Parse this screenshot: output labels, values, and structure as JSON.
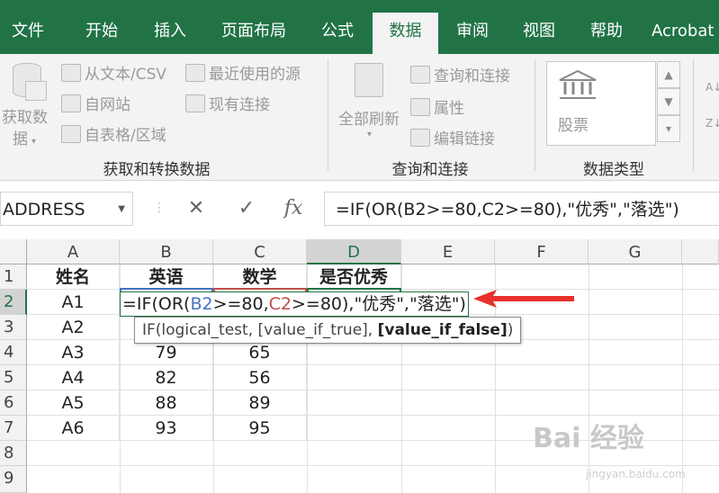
{
  "tabs": [
    "文件",
    "开始",
    "插入",
    "页面布局",
    "公式",
    "数据",
    "审阅",
    "视图",
    "帮助",
    "Acrobat"
  ],
  "active_tab": "数据",
  "ribbon": {
    "get_data": {
      "label_line1": "获取数",
      "label_line2": "据"
    },
    "from_text": "从文本/CSV",
    "from_web": "自网站",
    "from_table": "自表格/区域",
    "recent_sources": "最近使用的源",
    "existing_connections": "现有连接",
    "group1_label": "获取和转换数据",
    "refresh_all": "全部刷新",
    "queries_connections": "查询和连接",
    "properties": "属性",
    "edit_links": "编辑链接",
    "group2_label": "查询和连接",
    "stocks": "股票",
    "group3_label": "数据类型"
  },
  "formula_bar": {
    "name_box": "ADDRESS",
    "cancel_symbol": "✕",
    "enter_symbol": "✓",
    "fx_symbol": "fx",
    "formula": "=IF(OR(B2>=80,C2>=80),\"优秀\",\"落选\")"
  },
  "columns": [
    "A",
    "B",
    "C",
    "D",
    "E",
    "F",
    "G"
  ],
  "rows": [
    "1",
    "2",
    "3",
    "4",
    "5",
    "6",
    "7",
    "8",
    "9"
  ],
  "cells": {
    "A1": "姓名",
    "B1": "英语",
    "C1": "数学",
    "D1": "是否优秀",
    "A2": "A1",
    "A3": "A2",
    "A4": "A3",
    "B4": "79",
    "C4": "65",
    "A5": "A4",
    "B5": "82",
    "C5": "56",
    "A6": "A5",
    "B6": "88",
    "C6": "89",
    "A7": "A6",
    "B7": "93",
    "C7": "95"
  },
  "editor": {
    "p1": "=IF(OR(",
    "ref_b": "B2",
    "p2": ">=80,",
    "ref_c": "C2",
    "p3": ">=80),\"优秀\",\"落选\")"
  },
  "tooltip": {
    "prefix": "IF(logical_test, [value_if_true], ",
    "bold": "[value_if_false]",
    "suffix": ")"
  },
  "watermark": {
    "main": "Bai 经验",
    "sub": "jingyan.baidu.com"
  },
  "colors": {
    "excel_green": "#217346",
    "ref_b": "#4472c4",
    "ref_c": "#c0504d",
    "arrow": "#e8302c"
  }
}
